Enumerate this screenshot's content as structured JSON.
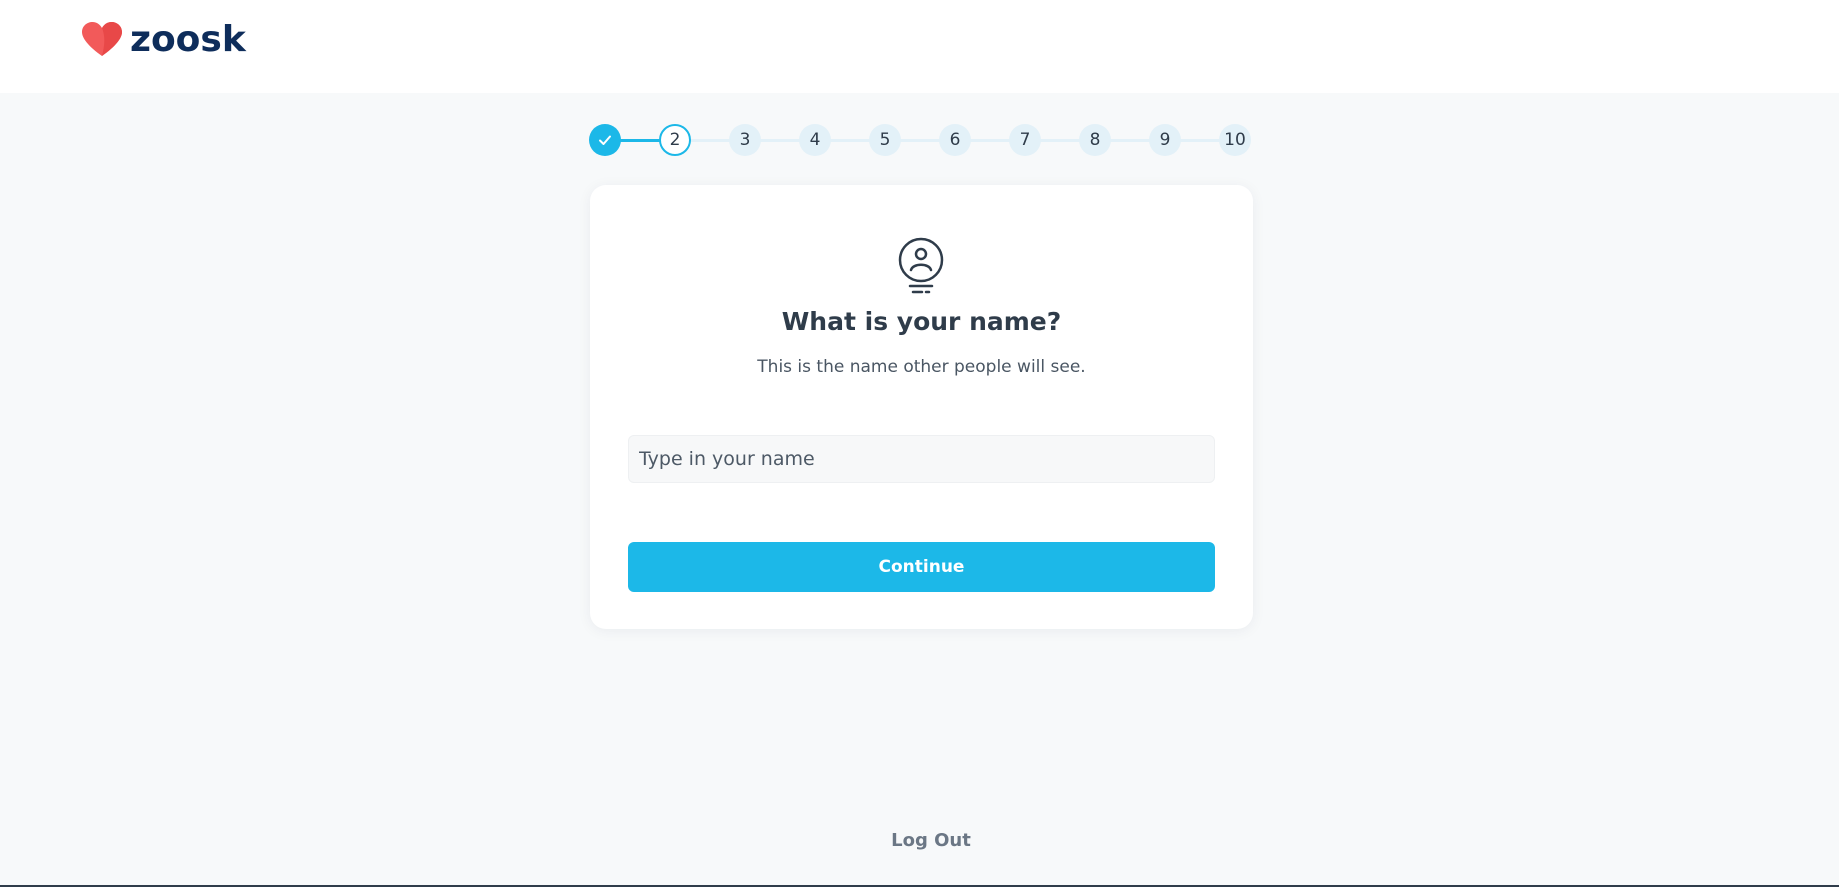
{
  "brand": {
    "name": "zoosk",
    "logo_icon": "heart-icon",
    "colors": {
      "heart": "#f25a5a",
      "text": "#0e2d5b"
    }
  },
  "progress": {
    "current_step": 2,
    "total_steps": 10,
    "steps": [
      {
        "label": "",
        "state": "done",
        "icon": "check-icon"
      },
      {
        "label": "2",
        "state": "active"
      },
      {
        "label": "3",
        "state": "pending"
      },
      {
        "label": "4",
        "state": "pending"
      },
      {
        "label": "5",
        "state": "pending"
      },
      {
        "label": "6",
        "state": "pending"
      },
      {
        "label": "7",
        "state": "pending"
      },
      {
        "label": "8",
        "state": "pending"
      },
      {
        "label": "9",
        "state": "pending"
      },
      {
        "label": "10",
        "state": "pending"
      }
    ]
  },
  "card": {
    "icon": "profile-badge-icon",
    "title": "What is your name?",
    "subtitle": "This is the name other people will see.",
    "name_input": {
      "placeholder": "Type in your name",
      "value": ""
    },
    "continue_label": "Continue"
  },
  "footer": {
    "logout_label": "Log Out"
  },
  "theme": {
    "accent": "#1cb8e8",
    "background": "#f7f9fa",
    "card": "#ffffff"
  }
}
